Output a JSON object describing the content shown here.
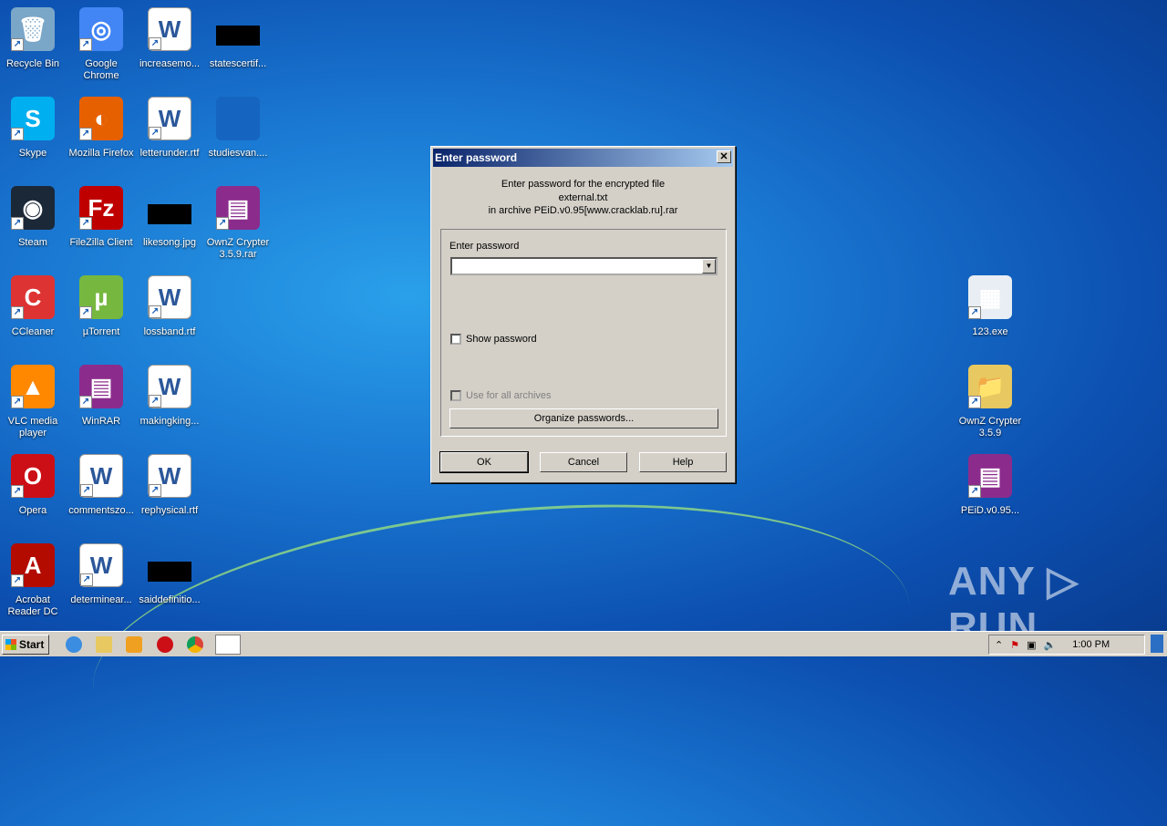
{
  "desktop": {
    "columns": [
      [
        {
          "label": "Recycle Bin",
          "color": "#7aa6c8",
          "glyph": "🗑"
        },
        {
          "label": "Skype",
          "color": "#00aff0",
          "glyph": "S"
        },
        {
          "label": "Steam",
          "color": "#1b2838",
          "glyph": "◉"
        },
        {
          "label": "CCleaner",
          "color": "#d33",
          "glyph": "C"
        },
        {
          "label": "VLC media player",
          "color": "#f80",
          "glyph": "▲"
        },
        {
          "label": "Opera",
          "color": "#cc0f16",
          "glyph": "O"
        },
        {
          "label": "Acrobat Reader DC",
          "color": "#b30b00",
          "glyph": "A"
        }
      ],
      [
        {
          "label": "Google Chrome",
          "color": "#4285f4",
          "glyph": "◎"
        },
        {
          "label": "Mozilla Firefox",
          "color": "#e66000",
          "glyph": "◐"
        },
        {
          "label": "FileZilla Client",
          "color": "#bf0000",
          "glyph": "Fz"
        },
        {
          "label": "µTorrent",
          "color": "#76b83f",
          "glyph": "µ"
        },
        {
          "label": "WinRAR",
          "color": "#8b2c8c",
          "glyph": "▤"
        },
        {
          "label": "commentszo...",
          "color": "#2b579a",
          "glyph": "W"
        },
        {
          "label": "determinear...",
          "color": "#2b579a",
          "glyph": "W"
        }
      ],
      [
        {
          "label": "increasemo...",
          "color": "#2b579a",
          "glyph": "W"
        },
        {
          "label": "letterunder.rtf",
          "color": "#2b579a",
          "glyph": "W"
        },
        {
          "label": "likesong.jpg",
          "color": "#000",
          "glyph": ""
        },
        {
          "label": "lossband.rtf",
          "color": "#2b579a",
          "glyph": "W"
        },
        {
          "label": "makingking...",
          "color": "#2b579a",
          "glyph": "W"
        },
        {
          "label": "rephysical.rtf",
          "color": "#2b579a",
          "glyph": "W"
        },
        {
          "label": "saiddefinitio...",
          "color": "#000",
          "glyph": ""
        }
      ],
      [
        {
          "label": "statescertif...",
          "color": "#000",
          "glyph": ""
        },
        {
          "label": "studiesvan....",
          "color": "#1565c0",
          "glyph": ""
        },
        {
          "label": "OwnZ Crypter 3.5.9.rar",
          "color": "#8b2c8c",
          "glyph": "▤"
        }
      ]
    ],
    "right_column": [
      {
        "label": "123.exe",
        "color": "#e8eef4",
        "glyph": "▦"
      },
      {
        "label": "OwnZ Crypter 3.5.9",
        "color": "#e8c860",
        "glyph": "📁"
      },
      {
        "label": "PEiD.v0.95...",
        "color": "#8b2c8c",
        "glyph": "▤"
      }
    ]
  },
  "dialog": {
    "title": "Enter password",
    "message_line1": "Enter password for the encrypted file",
    "message_line2": "external.txt",
    "message_line3": "in archive PEiD.v0.95[www.cracklab.ru].rar",
    "password_label": "Enter password",
    "password_value": "",
    "show_password": "Show password",
    "use_for_all": "Use for all archives",
    "organize": "Organize passwords...",
    "ok": "OK",
    "cancel": "Cancel",
    "help": "Help",
    "close": "✕"
  },
  "taskbar": {
    "start": "Start",
    "clock": "1:00 PM"
  },
  "watermark": "ANY ▷ RUN"
}
